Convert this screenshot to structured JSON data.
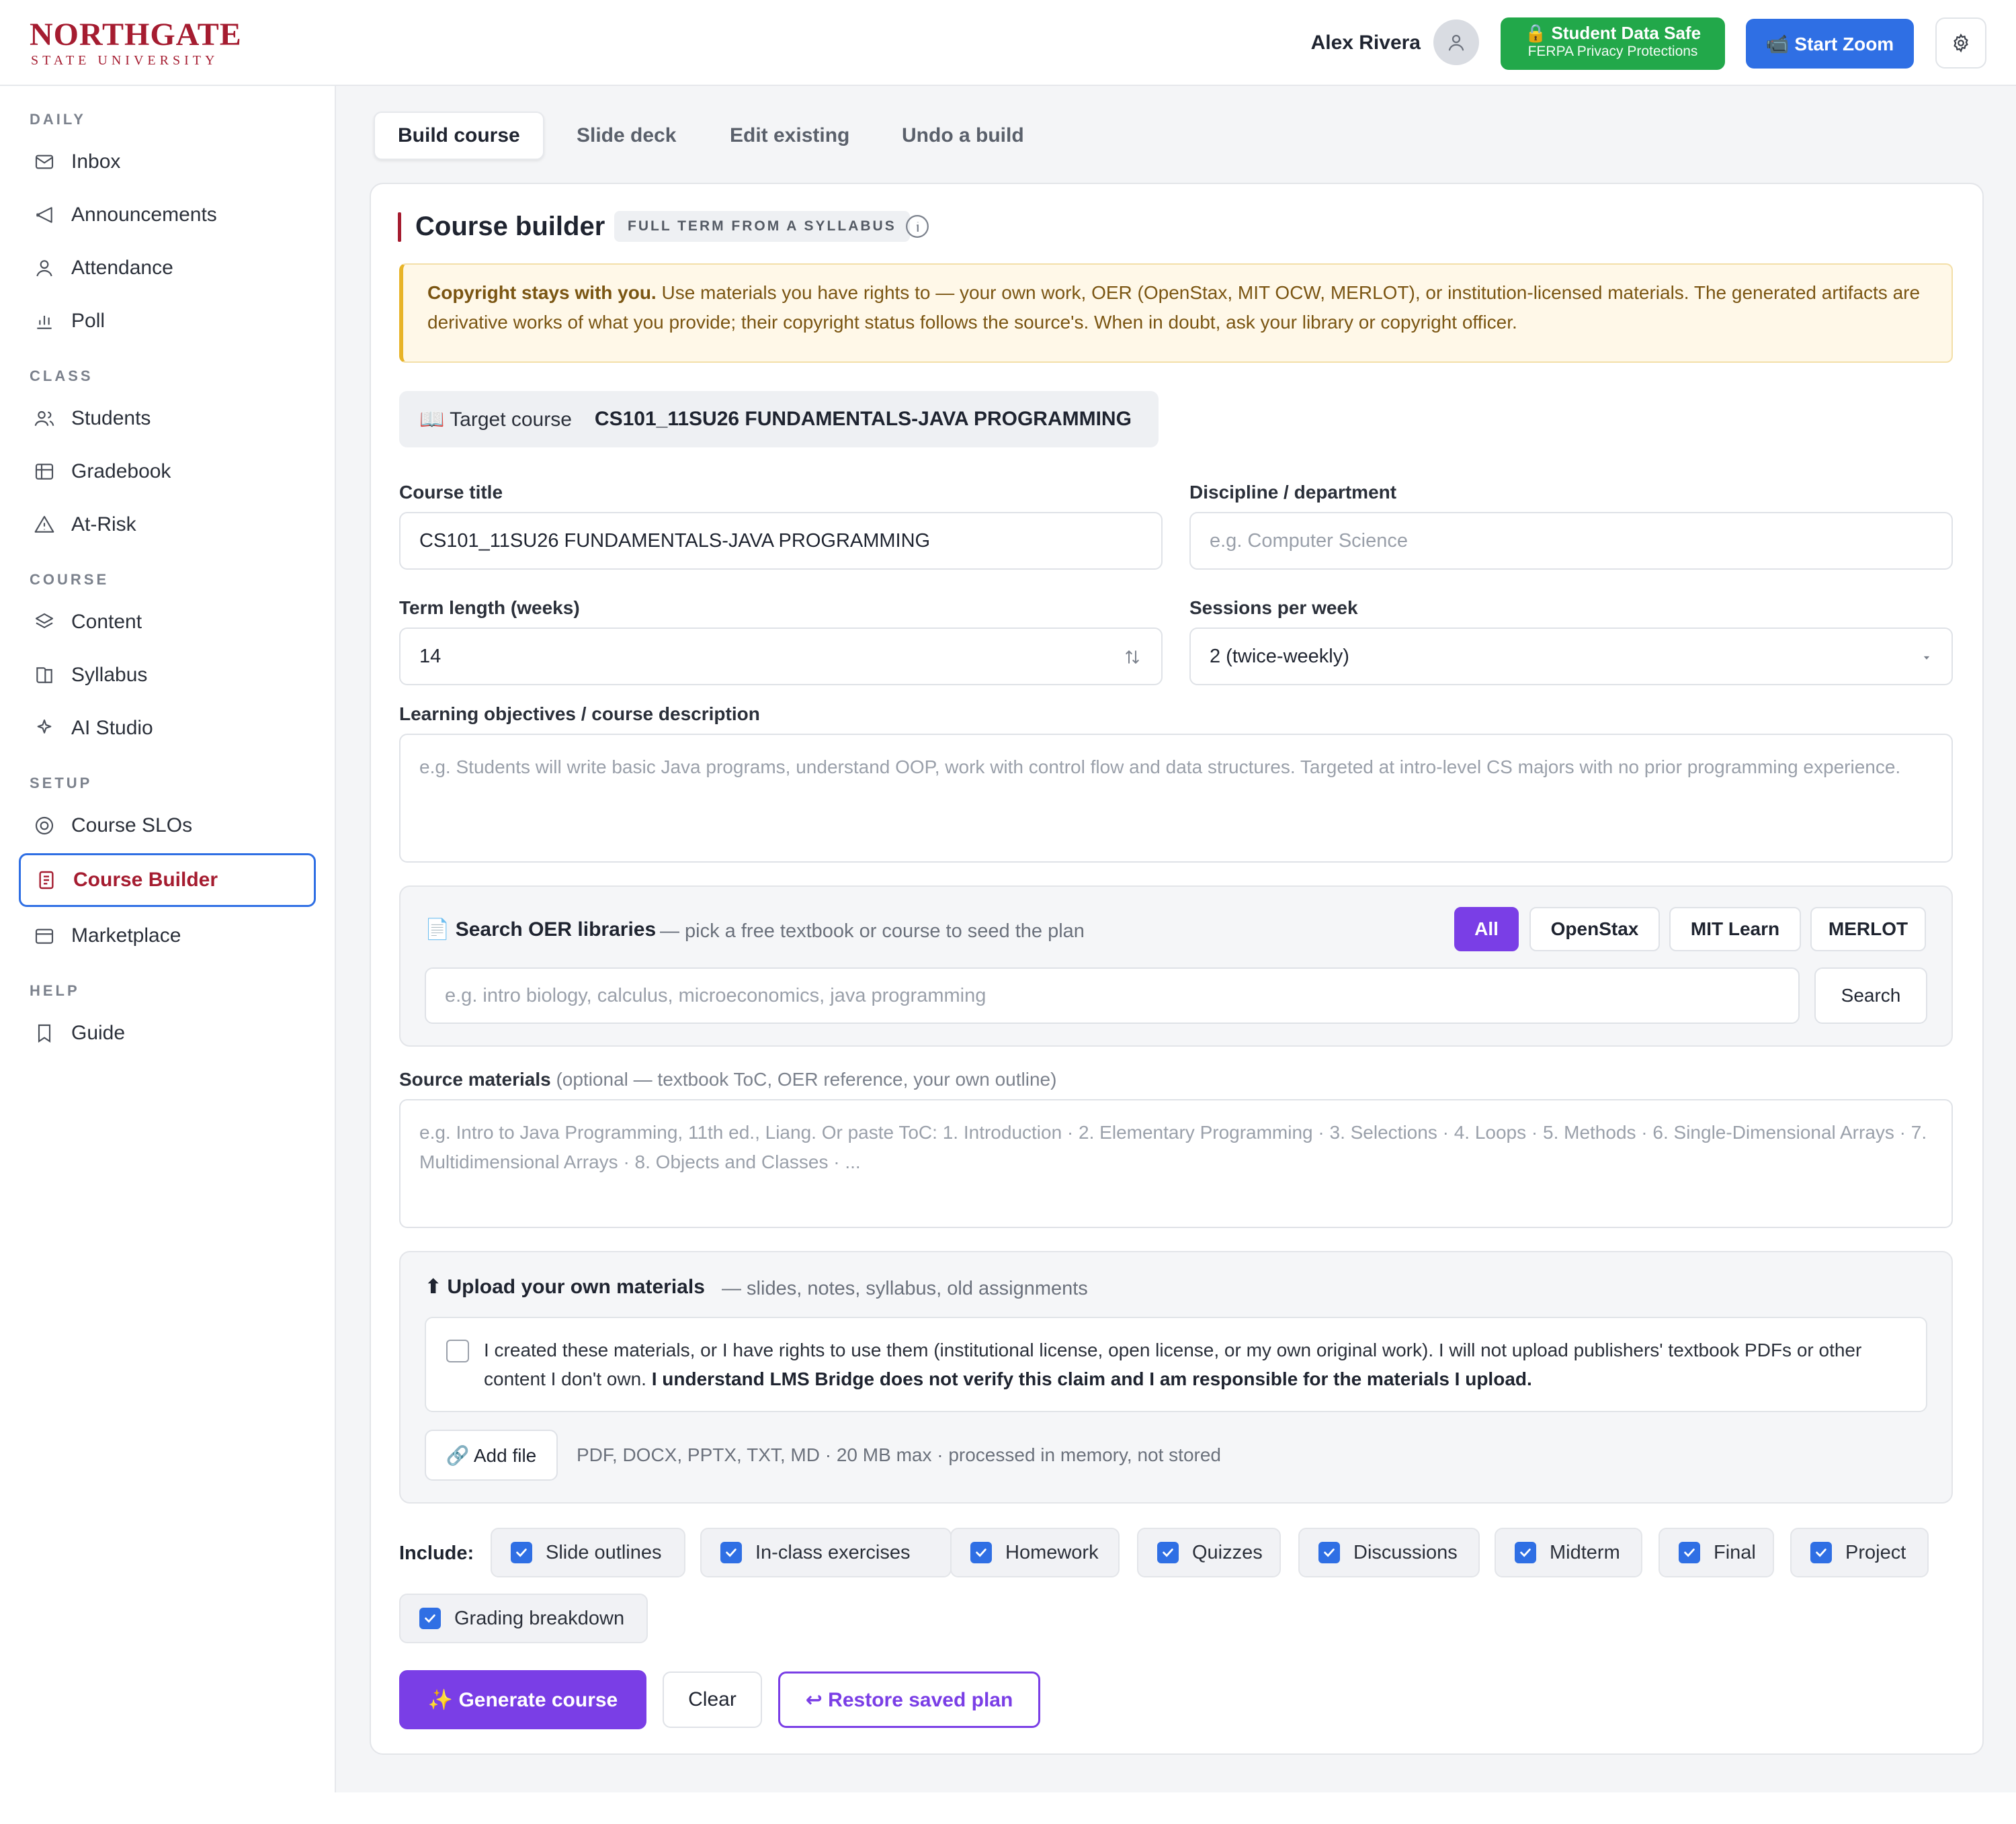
{
  "brand": {
    "name": "NORTHGATE",
    "subtitle": "STATE UNIVERSITY",
    "accent": "#a51c30"
  },
  "header": {
    "user_name": "Alex Rivera",
    "ferpa_title": "🔒 Student Data Safe",
    "ferpa_subtitle": "FERPA Privacy Protections",
    "zoom_label": "📹 Start Zoom"
  },
  "sidebar": {
    "sections": {
      "daily": "DAILY",
      "class": "CLASS",
      "course": "COURSE",
      "setup": "SETUP",
      "help": "HELP"
    },
    "items": {
      "inbox": "Inbox",
      "announcements": "Announcements",
      "attendance": "Attendance",
      "poll": "Poll",
      "students": "Students",
      "gradebook": "Gradebook",
      "at_risk": "At-Risk",
      "content": "Content",
      "syllabus": "Syllabus",
      "ai_studio": "AI Studio",
      "course_slos": "Course SLOs",
      "course_builder": "Course Builder",
      "marketplace": "Marketplace",
      "guide": "Guide"
    },
    "active_item": "Course Builder"
  },
  "tabs": [
    "Build course",
    "Slide deck",
    "Edit existing",
    "Undo a build"
  ],
  "builder": {
    "title": "Course builder",
    "badge": "FULL TERM FROM A SYLLABUS",
    "notice_bold": "Copyright stays with you.",
    "notice_text": " Use materials you have rights to — your own work, OER (OpenStax, MIT OCW, MERLOT), or institution-licensed materials. The generated artifacts are derivative works of what you provide; their copyright status follows the source's. When in doubt, ask your library or copyright officer.",
    "target_label": "📖 Target course",
    "target_course": "CS101_11SU26 FUNDAMENTALS-JAVA PROGRAMMING"
  },
  "form": {
    "course_title_label": "Course title",
    "course_title_value": "CS101_11SU26 FUNDAMENTALS-JAVA PROGRAMMING",
    "discipline_label": "Discipline / department",
    "discipline_placeholder": "e.g. Computer Science",
    "term_length_label": "Term length (weeks)",
    "term_length_value": "14",
    "sessions_label": "Sessions per week",
    "sessions_value": "2 (twice-weekly)",
    "objectives_label": "Learning objectives / course description",
    "objectives_placeholder": "e.g. Students will write basic Java programs, understand OOP, work with control flow and data structures. Targeted at intro-level CS majors with no prior programming experience.",
    "source_label": "Source materials",
    "source_hint": " (optional — textbook ToC, OER reference, your own outline)",
    "source_placeholder": "e.g. Intro to Java Programming, 11th ed., Liang. Or paste ToC: 1. Introduction · 2. Elementary Programming · 3. Selections · 4. Loops · 5. Methods · 6. Single-Dimensional Arrays · 7. Multidimensional Arrays · 8. Objects and Classes · ..."
  },
  "oer": {
    "title": "📄 Search OER libraries",
    "subtitle": "— pick a free textbook or course to seed the plan",
    "filters": [
      "All",
      "OpenStax",
      "MIT Learn",
      "MERLOT"
    ],
    "active_filter": "All",
    "search_placeholder": "e.g. intro biology, calculus, microeconomics, java programming",
    "search_button": "Search"
  },
  "upload": {
    "title": "⬆ Upload your own materials",
    "subtitle": "— slides, notes, syllabus, old assignments",
    "ack_text": "I created these materials, or I have rights to use them (institutional license, open license, or my own original work). I will not upload publishers' textbook PDFs or other content I don't own. ",
    "ack_bold": "I understand LMS Bridge does not verify this claim and I am responsible for the materials I upload.",
    "ack_checked": false,
    "add_file": "🔗 Add file",
    "file_hint": "PDF, DOCX, PPTX, TXT, MD · 20 MB max · processed in memory, not stored"
  },
  "include": {
    "label": "Include:",
    "options": [
      "Slide outlines",
      "In-class exercises",
      "Homework",
      "Quizzes",
      "Discussions",
      "Midterm",
      "Final",
      "Project",
      "Grading breakdown"
    ]
  },
  "actions": {
    "generate": "✨ Generate course",
    "clear": "Clear",
    "restore": "↩ Restore saved plan"
  },
  "colors": {
    "primary_blue": "#2f6fe4",
    "purple": "#7a3ee6",
    "green": "#22a84a",
    "notice_bg": "#fff8e8"
  }
}
